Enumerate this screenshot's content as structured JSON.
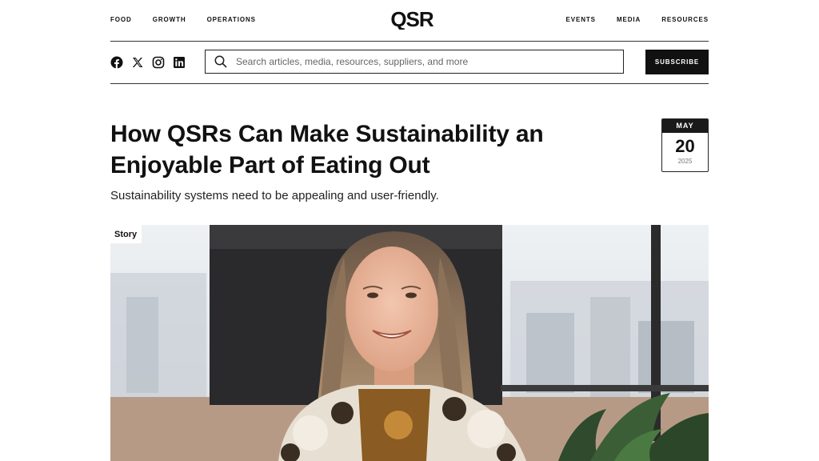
{
  "nav": {
    "left": [
      "FOOD",
      "GROWTH",
      "OPERATIONS"
    ],
    "right": [
      "EVENTS",
      "MEDIA",
      "RESOURCES"
    ],
    "logo": "QSR"
  },
  "social": [
    "facebook-icon",
    "x-icon",
    "instagram-icon",
    "linkedin-icon"
  ],
  "search": {
    "placeholder": "Search articles, media, resources, suppliers, and more"
  },
  "subscribe_label": "SUBSCRIBE",
  "article": {
    "title": "How QSRs Can Make Sustainability an Enjoyable Part of Eating Out",
    "subtitle": "Sustainability systems need to be appealing and user-friendly.",
    "date": {
      "month": "MAY",
      "day": "20",
      "year": "2025"
    },
    "tag": "Story"
  }
}
